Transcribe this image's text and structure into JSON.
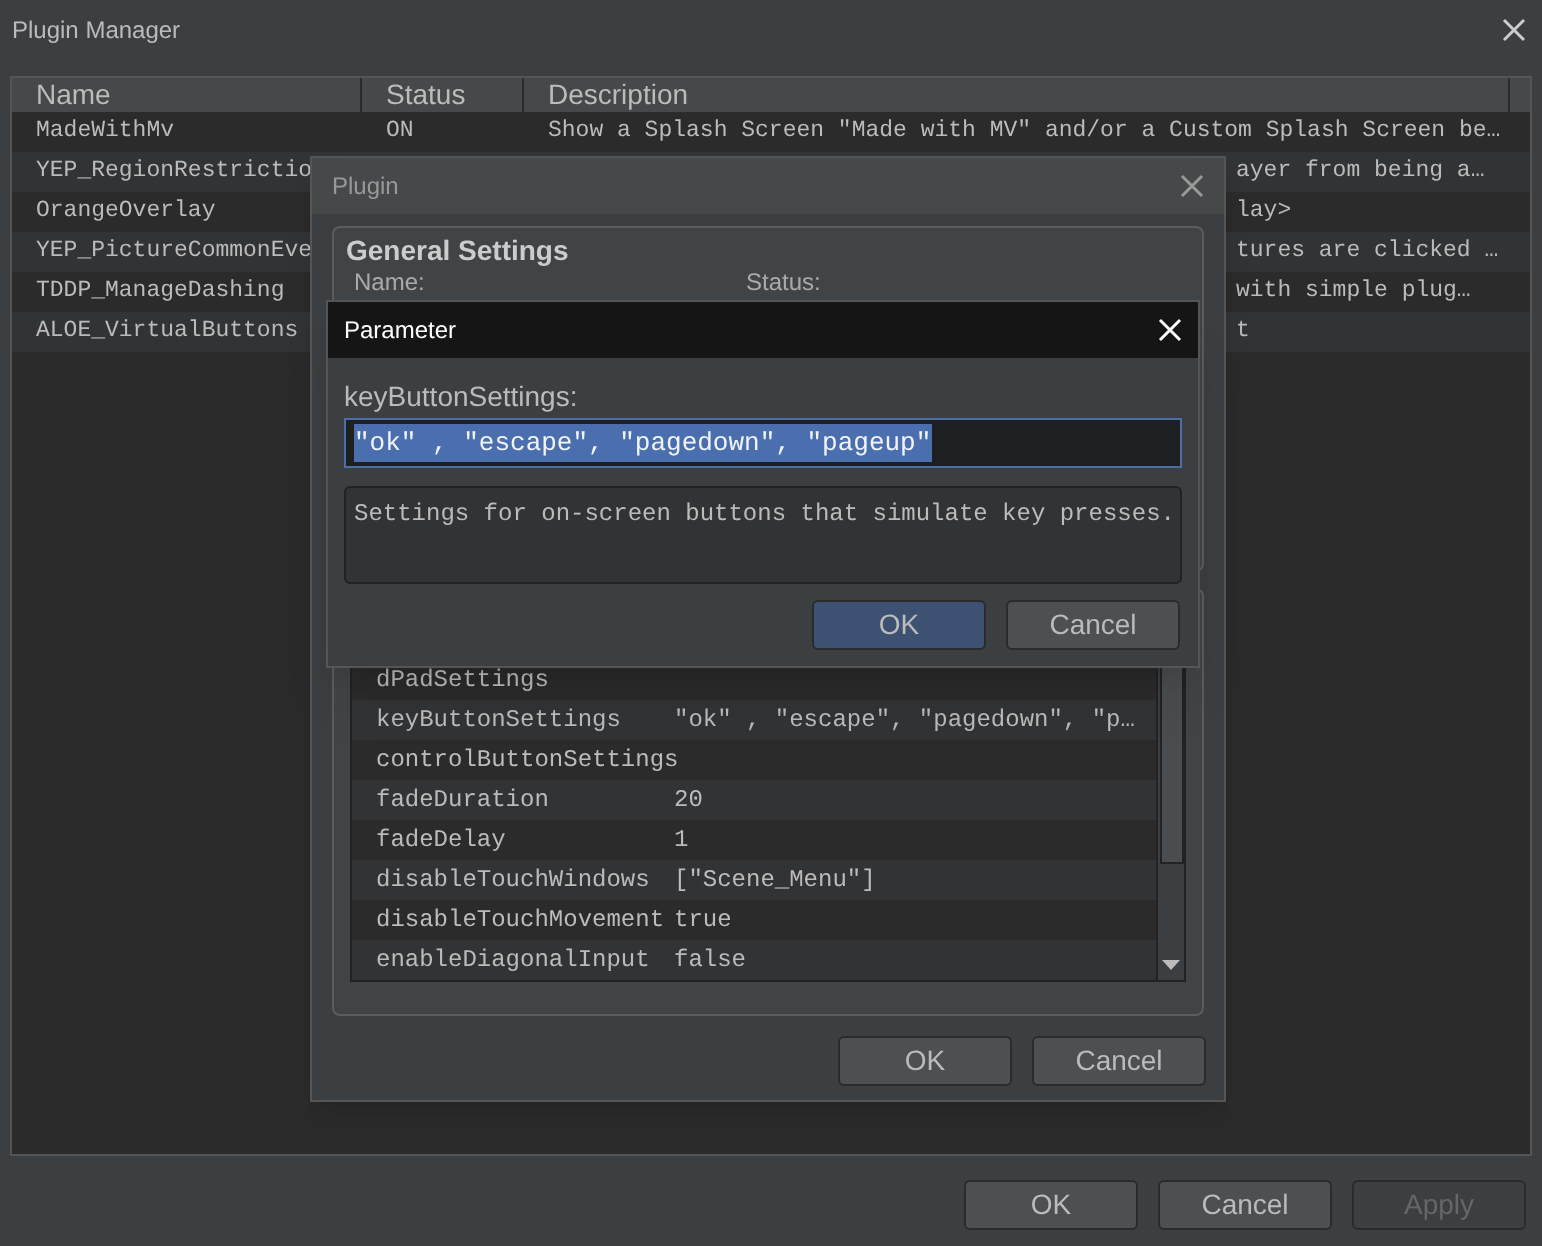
{
  "window": {
    "title": "Plugin Manager"
  },
  "table": {
    "columns": [
      "Name",
      "Status",
      "Description"
    ],
    "rows": [
      {
        "kind": "full",
        "name": "MadeWithMv",
        "status": "ON",
        "description": "Show a Splash Screen \"Made with MV\" and/or a Custom Splash Screen be…"
      },
      {
        "kind": "clipped",
        "name": "YEP_RegionRestrictio",
        "description": "ayer from being a…"
      },
      {
        "kind": "clipped",
        "name": "OrangeOverlay",
        "description": "lay>"
      },
      {
        "kind": "clipped",
        "name": "YEP_PictureCommonEve",
        "description": "tures are clicked …"
      },
      {
        "kind": "clipped",
        "name": "TDDP_ManageDashing",
        "description": "with simple plug…"
      },
      {
        "kind": "clipped",
        "name": "ALOE_VirtualButtons",
        "description": "t"
      }
    ]
  },
  "buttons": [
    {
      "label": "OK",
      "disabled": false
    },
    {
      "label": "Cancel",
      "disabled": false
    },
    {
      "label": "Apply",
      "disabled": true
    }
  ],
  "plugin_dialog": {
    "title": "Plugin",
    "section_title": "General Settings",
    "labels": [
      "Name:",
      "Status:"
    ],
    "parameters": [
      {
        "name": "dPadSettings"
      },
      {
        "name": "keyButtonSettings",
        "value": "\"ok\" , \"escape\", \"pagedown\", \"p…"
      },
      {
        "name": "controlButtonSettings"
      },
      {
        "name": "fadeDuration",
        "value": "20"
      },
      {
        "name": "fadeDelay",
        "value": "1"
      },
      {
        "name": "disableTouchWindows",
        "value": "[\"Scene_Menu\"]"
      },
      {
        "name": "disableTouchMovement",
        "value": "true"
      },
      {
        "name": "enableDiagonalInput",
        "value": "false"
      }
    ],
    "buttons": [
      "OK",
      "Cancel"
    ]
  },
  "parameter_dialog": {
    "title": "Parameter",
    "label": "keyButtonSettings:",
    "value": "\"ok\" , \"escape\", \"pagedown\", \"pageup\"",
    "value_selected": true,
    "description": "Settings for on-screen buttons that simulate key presses.",
    "buttons": [
      {
        "label": "OK",
        "default": true
      },
      {
        "label": "Cancel",
        "default": false
      }
    ]
  }
}
